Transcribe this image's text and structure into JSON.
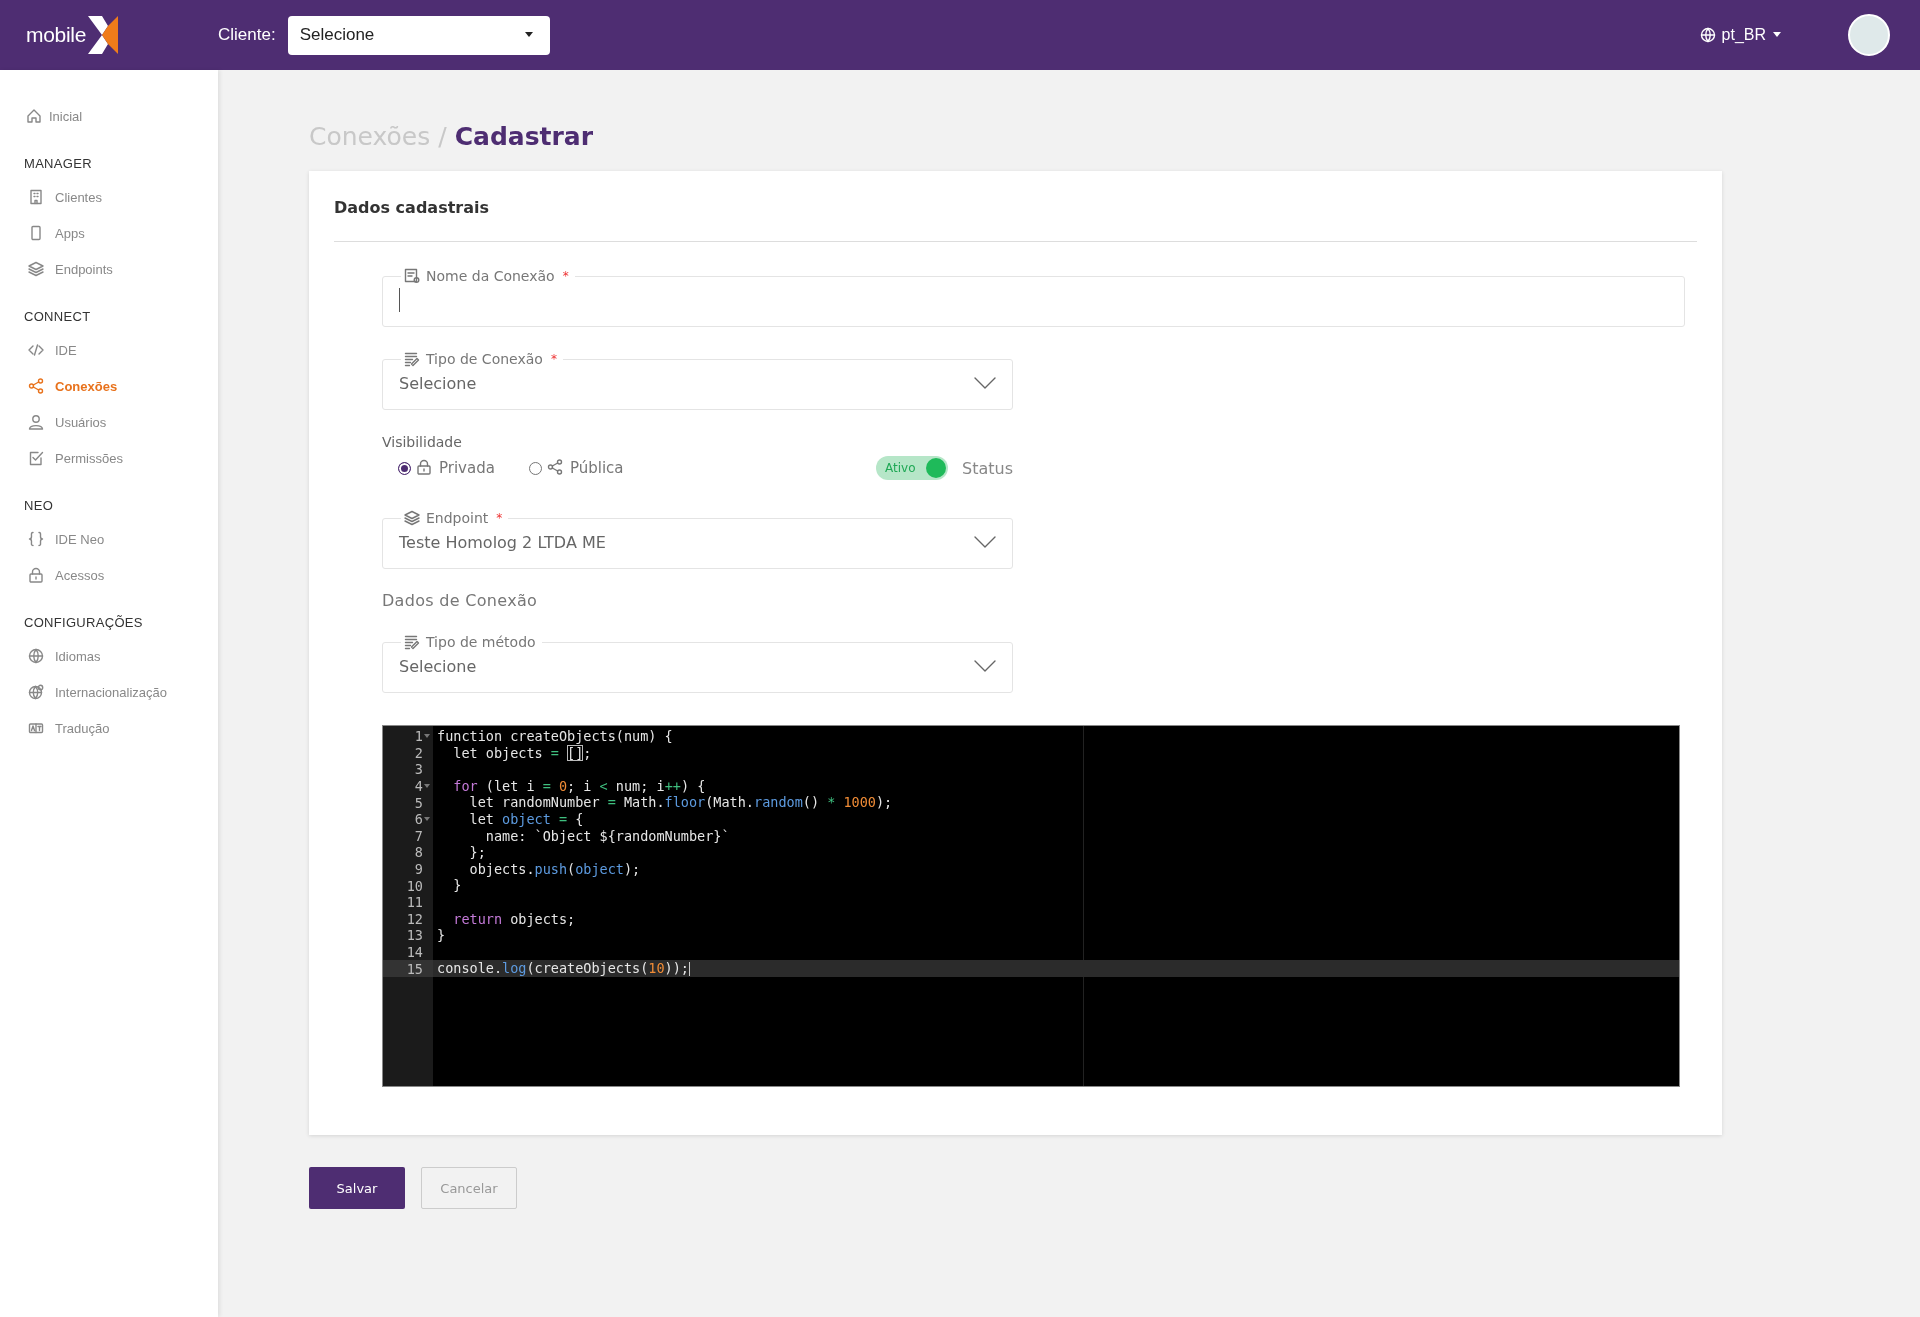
{
  "header": {
    "logo": "mobile",
    "client_label": "Cliente:",
    "client_select": {
      "value": "Selecione"
    },
    "language": "pt_BR"
  },
  "sidebar": {
    "sections": [
      {
        "items": [
          {
            "label": "Inicial",
            "selected": false
          }
        ]
      },
      {
        "title": "MANAGER",
        "items": [
          {
            "label": "Clientes",
            "selected": false
          },
          {
            "label": "Apps",
            "selected": false
          },
          {
            "label": "Endpoints",
            "selected": false
          }
        ]
      },
      {
        "title": "CONNECT",
        "items": [
          {
            "label": "IDE",
            "selected": false
          },
          {
            "label": "Conexões",
            "selected": true
          },
          {
            "label": "Usuários",
            "selected": false
          },
          {
            "label": "Permissões",
            "selected": false
          }
        ]
      },
      {
        "title": "NEO",
        "items": [
          {
            "label": "IDE Neo",
            "selected": false
          },
          {
            "label": "Acessos",
            "selected": false
          }
        ]
      },
      {
        "title": "CONFIGURAÇÕES",
        "items": [
          {
            "label": "Idiomas",
            "selected": false
          },
          {
            "label": "Internacionalização",
            "selected": false
          },
          {
            "label": "Tradução",
            "selected": false
          }
        ]
      }
    ]
  },
  "breadcrumb": {
    "parent": "Conexões",
    "separator": "/",
    "current": "Cadastrar"
  },
  "card": {
    "title": "Dados cadastrais",
    "name_field": {
      "label": "Nome da Conexão",
      "required": true
    },
    "type_field": {
      "label": "Tipo de Conexão",
      "required": true,
      "value": "Selecione"
    },
    "visibility": {
      "label": "Visibilidade",
      "options": [
        {
          "label": "Privada",
          "selected": true
        },
        {
          "label": "Pública",
          "selected": false
        }
      ]
    },
    "status": {
      "toggle_label": "Ativo",
      "on": true,
      "label": "Status"
    },
    "endpoint_field": {
      "label": "Endpoint",
      "required": true,
      "value": "Teste Homolog 2 LTDA ME"
    },
    "section_title": "Dados de Conexão",
    "method_field": {
      "label": "Tipo de método",
      "required": false,
      "value": "Selecione"
    },
    "code_editor": {
      "lines": [
        {
          "number": "1",
          "foldable": true,
          "active": false,
          "tokens": [
            {
              "t": "function createObjects(num) {"
            }
          ]
        },
        {
          "number": "2",
          "foldable": false,
          "active": false,
          "tokens": [
            {
              "t": "  let objects "
            },
            {
              "t": "= ",
              "kind": "op"
            },
            {
              "t": "[]",
              "kind": "match"
            },
            {
              "t": ";"
            }
          ]
        },
        {
          "number": "3",
          "foldable": false,
          "active": false
        },
        {
          "number": "4",
          "foldable": true,
          "active": false,
          "tokens": [
            {
              "t": "  for",
              "kind": "keyword"
            },
            {
              "t": " (let i "
            },
            {
              "t": "= ",
              "kind": "op"
            },
            {
              "t": "0",
              "kind": "number"
            },
            {
              "t": "; i "
            },
            {
              "t": "< ",
              "kind": "op"
            },
            {
              "t": "num; i"
            },
            {
              "t": "++",
              "kind": "op"
            },
            {
              "t": ") {"
            }
          ]
        },
        {
          "number": "5",
          "foldable": false,
          "active": false,
          "tokens": [
            {
              "t": "    let randomNumber "
            },
            {
              "t": "= ",
              "kind": "op"
            },
            {
              "t": "Math."
            },
            {
              "t": "floor",
              "kind": "func"
            },
            {
              "t": "(Math."
            },
            {
              "t": "random",
              "kind": "func"
            },
            {
              "t": "() "
            },
            {
              "t": "* ",
              "kind": "op"
            },
            {
              "t": "1000",
              "kind": "number"
            },
            {
              "t": ");"
            }
          ]
        },
        {
          "number": "6",
          "foldable": true,
          "active": false,
          "tokens": [
            {
              "t": "    let "
            },
            {
              "t": "object ",
              "kind": "func"
            },
            {
              "t": "= ",
              "kind": "op"
            },
            {
              "t": "{"
            }
          ]
        },
        {
          "number": "7",
          "foldable": false,
          "active": false,
          "tokens": [
            {
              "t": "      name: `Object ${randomNumber}`"
            }
          ]
        },
        {
          "number": "8",
          "foldable": false,
          "active": false,
          "tokens": [
            {
              "t": "    };"
            }
          ]
        },
        {
          "number": "9",
          "foldable": false,
          "active": false,
          "tokens": [
            {
              "t": "    objects."
            },
            {
              "t": "push",
              "kind": "func"
            },
            {
              "t": "("
            },
            {
              "t": "object",
              "kind": "func"
            },
            {
              "t": ");"
            }
          ]
        },
        {
          "number": "10",
          "foldable": false,
          "active": false,
          "tokens": [
            {
              "t": "  }"
            }
          ]
        },
        {
          "number": "11",
          "foldable": false,
          "active": false
        },
        {
          "number": "12",
          "foldable": false,
          "active": false,
          "tokens": [
            {
              "t": "  return",
              "kind": "keyword"
            },
            {
              "t": " objects;"
            }
          ]
        },
        {
          "number": "13",
          "foldable": false,
          "active": false,
          "tokens": [
            {
              "t": "}"
            }
          ]
        },
        {
          "number": "14",
          "foldable": false,
          "active": false
        },
        {
          "number": "15",
          "foldable": false,
          "active": true,
          "tokens": [
            {
              "t": "console."
            },
            {
              "t": "log",
              "kind": "func"
            },
            {
              "t": "(createObjects("
            },
            {
              "t": "10",
              "kind": "number"
            },
            {
              "t": "));"
            }
          ]
        }
      ]
    }
  },
  "buttons": [
    {
      "label": "Salvar",
      "kind": "primary"
    },
    {
      "label": "Cancelar",
      "kind": "secondary"
    }
  ]
}
